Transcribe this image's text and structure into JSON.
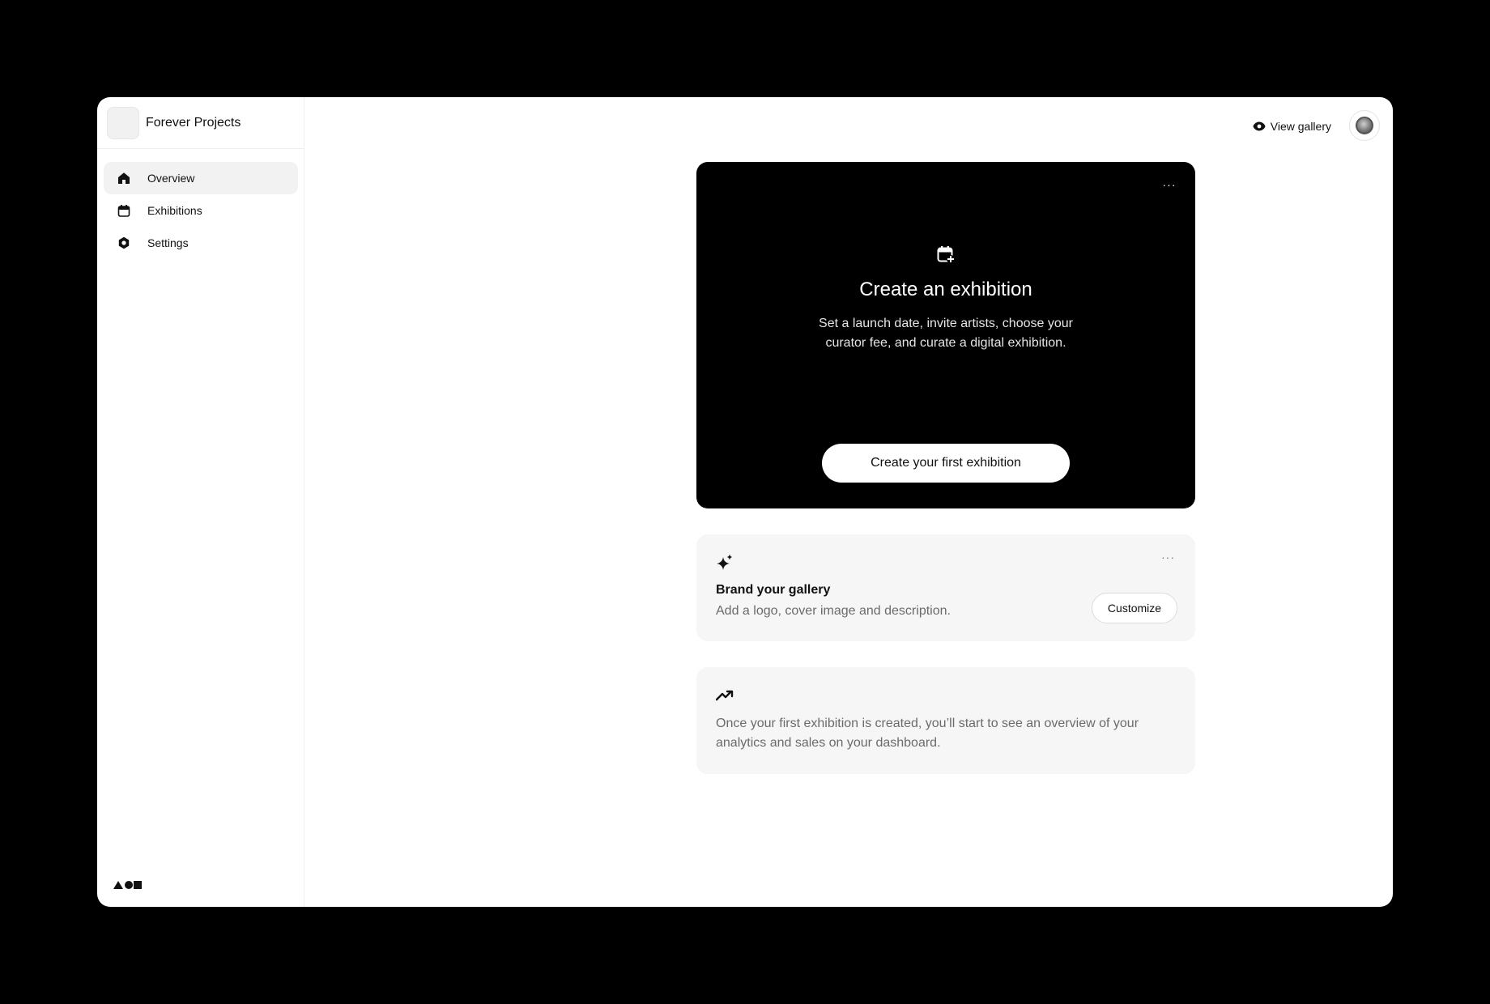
{
  "brand": {
    "name": "Forever Projects"
  },
  "sidebar": {
    "items": [
      {
        "label": "Overview",
        "icon": "home-icon",
        "active": true
      },
      {
        "label": "Exhibitions",
        "icon": "calendar-icon",
        "active": false
      },
      {
        "label": "Settings",
        "icon": "settings-icon",
        "active": false
      }
    ]
  },
  "topbar": {
    "view_gallery": "View gallery"
  },
  "hero": {
    "title": "Create an exhibition",
    "description": "Set a launch date, invite artists, choose your curator fee, and curate a digital exhibition.",
    "cta": "Create your first exhibition",
    "more": "···"
  },
  "brand_card": {
    "title": "Brand your gallery",
    "description": "Add a logo, cover image and description.",
    "button": "Customize",
    "more": "···"
  },
  "analytics_card": {
    "text": "Once your first exhibition is created, you’ll start to see an overview of your analytics and sales on your dashboard."
  },
  "colors": {
    "background": "#000000",
    "surface": "#ffffff",
    "card": "#f6f6f6",
    "active_nav": "#f2f2f2",
    "muted_text": "#6b6b6b"
  }
}
